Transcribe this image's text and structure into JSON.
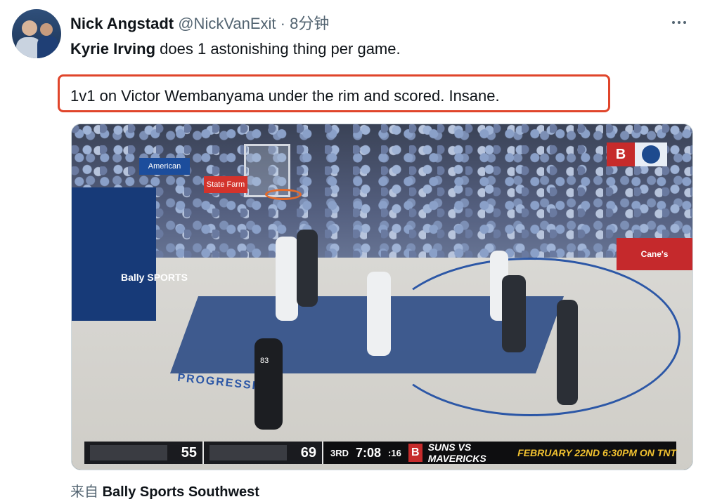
{
  "tweet": {
    "author_name": "Nick Angstadt",
    "handle": "@NickVanExit",
    "separator": "·",
    "time": "8分钟",
    "line1_bold": "Kyrie Irving",
    "line1_rest": " does 1 astonishing thing per game.",
    "line2": "1v1 on Victor Wembanyama under the rim and scored. Insane."
  },
  "media": {
    "scoreboard": {
      "team1_score": "55",
      "team2_score": "69",
      "period": "3RD",
      "clock": "7:08",
      "shot_clock": ":16",
      "promo_logo": "B",
      "promo_matchup": "SUNS VS MAVERICKS",
      "promo_date": "FEBRUARY 22ND 6:30PM ON TNT"
    },
    "corner_logo": "B",
    "ads": {
      "american": "American",
      "statefarm": "State Farm",
      "canes": "Cane's",
      "bally": "Bally SPORTS"
    },
    "floor_text": "PROGRESSIVE",
    "referee_number": "83"
  },
  "source": {
    "prefix": "来自",
    "name": "Bally Sports Southwest"
  },
  "colors": {
    "highlight_border": "#e0452b",
    "handle_gray": "#536471",
    "text": "#0f1419"
  }
}
